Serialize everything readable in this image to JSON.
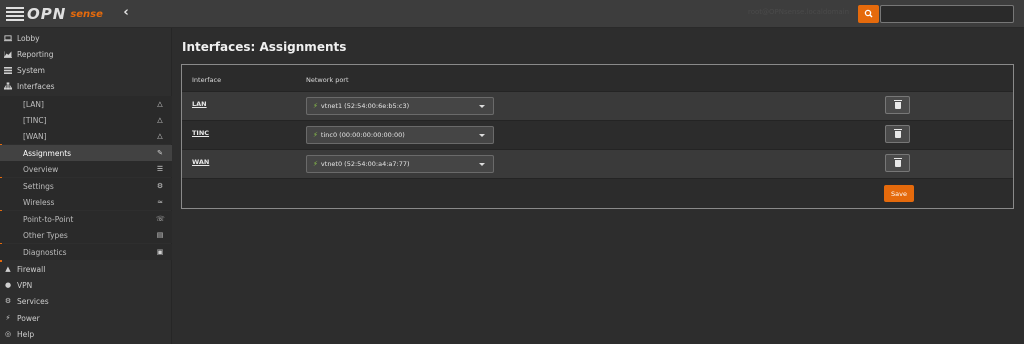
{
  "header": {
    "logo_text": "OPN",
    "logo_sense": "sense",
    "collapse_icon": "chevron-left-icon",
    "user_text": "root@OPNsense.localdomain",
    "search_placeholder": ""
  },
  "sidebar": {
    "items": [
      {
        "label": "Lobby",
        "icon": "laptop-icon"
      },
      {
        "label": "Reporting",
        "icon": "area-chart-icon"
      },
      {
        "label": "System",
        "icon": "server-icon"
      },
      {
        "label": "Interfaces",
        "icon": "sitemap-icon"
      },
      {
        "label": "[LAN]",
        "icon": "sitemap-icon"
      },
      {
        "label": "[TINC]",
        "icon": "sitemap-icon"
      },
      {
        "label": "[WAN]",
        "icon": "sitemap-icon"
      },
      {
        "label": "Assignments",
        "icon": "pencil-icon"
      },
      {
        "label": "Overview",
        "icon": "tasks-icon"
      },
      {
        "label": "Settings",
        "icon": "cogs-icon"
      },
      {
        "label": "Wireless",
        "icon": "wifi-icon"
      },
      {
        "label": "Point-to-Point",
        "icon": "tty-icon"
      },
      {
        "label": "Other Types",
        "icon": "archive-icon"
      },
      {
        "label": "Diagnostics",
        "icon": "medkit-icon"
      },
      {
        "label": "Firewall",
        "icon": "fire-icon"
      },
      {
        "label": "VPN",
        "icon": "globe-icon"
      },
      {
        "label": "Services",
        "icon": "cog-icon"
      },
      {
        "label": "Power",
        "icon": "plug-icon"
      },
      {
        "label": "Help",
        "icon": "life-ring-icon"
      }
    ]
  },
  "main": {
    "title": "Interfaces: Assignments",
    "table": {
      "headers": [
        "Interface",
        "Network port"
      ],
      "rows": [
        {
          "interface": "LAN",
          "port": "vtnet1 (52:54:00:6e:b5:c3)"
        },
        {
          "interface": "TINC",
          "port": "tinc0 (00:00:00:00:00:00)"
        },
        {
          "interface": "WAN",
          "port": "vtnet0 (52:54:00:a4:a7:77)"
        }
      ]
    },
    "save_label": "Save"
  },
  "colors": {
    "accent": "#e56a0c",
    "plug": "#8bc34a"
  }
}
